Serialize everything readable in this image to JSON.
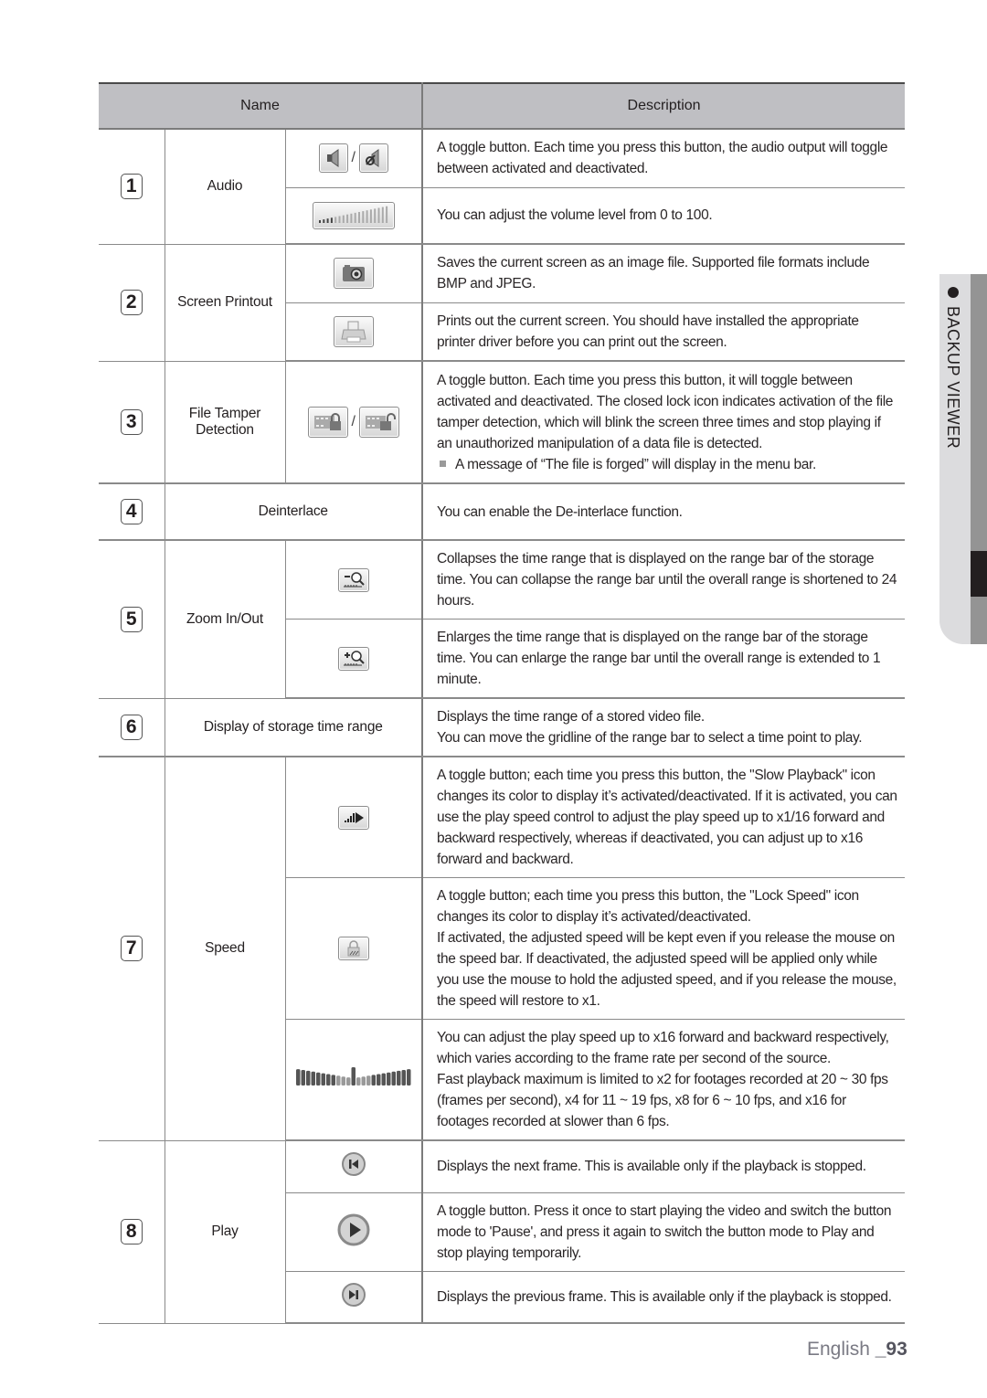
{
  "header": {
    "name": "Name",
    "description": "Description"
  },
  "side_tab": {
    "label": "BACKUP VIEWER"
  },
  "footer": {
    "language": "English",
    "page": "_93"
  },
  "rows": [
    {
      "number": "1",
      "name": "Audio",
      "items": [
        {
          "icons": [
            "speaker-on-icon",
            "speaker-mute-icon"
          ],
          "separator": "/",
          "description": [
            "A toggle button. Each time you press this button, the audio output will toggle between activated and deactivated."
          ]
        },
        {
          "icons": [
            "volume-slider-icon"
          ],
          "description": [
            "You can adjust the volume level from 0 to 100."
          ]
        }
      ]
    },
    {
      "number": "2",
      "name": "Screen Printout",
      "items": [
        {
          "icons": [
            "camera-icon"
          ],
          "description": [
            "Saves the current screen as an image file. Supported file formats include BMP and JPEG."
          ]
        },
        {
          "icons": [
            "printer-icon"
          ],
          "description": [
            "Prints out the current screen. You should have installed the appropriate printer driver before you can print out the screen."
          ]
        }
      ]
    },
    {
      "number": "3",
      "name_lines": [
        "File Tamper",
        "Detection"
      ],
      "items": [
        {
          "icons": [
            "film-lock-closed-icon",
            "film-lock-open-icon"
          ],
          "separator": "/",
          "description": [
            "A toggle button. Each time you press this button, it will toggle between activated and deactivated. The closed lock icon indicates activation of the file tamper detection, which will blink the screen three times and stop playing if an unauthorized manipulation of a data file is detected."
          ],
          "note": "A message of “The file is forged” will display in the menu bar."
        }
      ]
    },
    {
      "number": "4",
      "name": "Deinterlace",
      "items": [
        {
          "icons": [],
          "description": [
            "You can enable the De-interlace function."
          ]
        }
      ]
    },
    {
      "number": "5",
      "name": "Zoom In/Out",
      "items": [
        {
          "icons": [
            "zoom-out-icon"
          ],
          "description": [
            "Collapses the time range that is displayed on the range bar of the storage time. You can collapse the range bar until the overall range is shortened to 24 hours."
          ]
        },
        {
          "icons": [
            "zoom-in-icon"
          ],
          "description": [
            "Enlarges the time range that is displayed on the range bar of the storage time. You can enlarge the range bar until the overall range is extended to 1 minute."
          ]
        }
      ]
    },
    {
      "number": "6",
      "name": "Display of storage time range",
      "items": [
        {
          "icons": [],
          "description": [
            "Displays the time range of a stored video file.",
            "You can move the gridline of the range bar to select a time point to play."
          ]
        }
      ]
    },
    {
      "number": "7",
      "name": "Speed",
      "items": [
        {
          "icons": [
            "slow-playback-icon"
          ],
          "description": [
            "A toggle button; each time you press this button, the \"Slow Playback\" icon changes its color to display it’s activated/deactivated. If it is activated, you can use the play speed control to adjust the play speed up to x1/16 forward and backward respectively, whereas if deactivated, you can adjust up to x16 forward and backward."
          ]
        },
        {
          "icons": [
            "lock-speed-icon"
          ],
          "description": [
            "A toggle button; each time you press this button, the \"Lock Speed\" icon changes its color to display it’s activated/deactivated.",
            "If activated, the adjusted speed will be kept even if you release the mouse on the speed bar. If deactivated, the adjusted speed will be applied only while you use the mouse to hold the adjusted speed, and if you release the mouse, the speed will restore to x1."
          ]
        },
        {
          "icons": [
            "speed-bar-icon"
          ],
          "description": [
            "You can adjust the play speed up to x16 forward and backward respectively, which varies according to the frame rate per second of the source.",
            "Fast playback maximum is limited to x2 for footages recorded at 20 ~ 30 fps (frames per second), x4 for 11 ~ 19 fps, x8 for 6 ~ 10 fps, and x16 for footages recorded at slower than 6 fps."
          ]
        }
      ]
    },
    {
      "number": "8",
      "name": "Play",
      "items": [
        {
          "icons": [
            "next-frame-icon"
          ],
          "description": [
            "Displays the next frame. This is available only if the playback is stopped."
          ]
        },
        {
          "icons": [
            "play-icon"
          ],
          "description": [
            "A toggle button. Press it once to start playing the video and switch the button mode to 'Pause', and press it again to switch the button mode to Play and stop playing temporarily."
          ]
        },
        {
          "icons": [
            "previous-frame-icon"
          ],
          "description": [
            "Displays the previous frame. This is available only if the playback is stopped."
          ]
        }
      ]
    }
  ]
}
